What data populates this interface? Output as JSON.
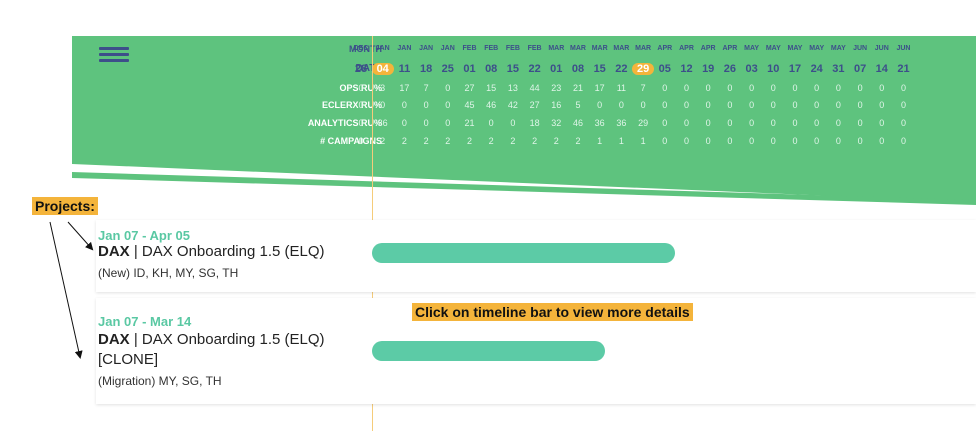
{
  "header": {
    "row_labels": [
      "MONTH",
      "DATE",
      "OPS RU%",
      "ECLERX RU%",
      "ANALYTICS RU%",
      "# CAMPAIGNS"
    ],
    "months": [
      "DEC",
      "JAN",
      "JAN",
      "JAN",
      "JAN",
      "FEB",
      "FEB",
      "FEB",
      "FEB",
      "MAR",
      "MAR",
      "MAR",
      "MAR",
      "MAR",
      "APR",
      "APR",
      "APR",
      "APR",
      "MAY",
      "MAY",
      "MAY",
      "MAY",
      "MAY",
      "JUN",
      "JUN",
      "JUN"
    ],
    "dates": [
      "28",
      "04",
      "11",
      "18",
      "25",
      "01",
      "08",
      "15",
      "22",
      "01",
      "08",
      "15",
      "22",
      "29",
      "05",
      "12",
      "19",
      "26",
      "03",
      "10",
      "17",
      "24",
      "31",
      "07",
      "14",
      "21"
    ],
    "highlighted_dates": [
      "04",
      "29"
    ],
    "ops_ru": [
      "0",
      "3",
      "17",
      "7",
      "0",
      "27",
      "15",
      "13",
      "44",
      "23",
      "21",
      "17",
      "11",
      "7",
      "0",
      "0",
      "0",
      "0",
      "0",
      "0",
      "0",
      "0",
      "0",
      "0",
      "0",
      "0"
    ],
    "eclerx_ru": [
      "0",
      "0",
      "0",
      "0",
      "0",
      "45",
      "46",
      "42",
      "27",
      "16",
      "5",
      "0",
      "0",
      "0",
      "0",
      "0",
      "0",
      "0",
      "0",
      "0",
      "0",
      "0",
      "0",
      "0",
      "0",
      "0"
    ],
    "analytics_ru": [
      "0",
      "36",
      "0",
      "0",
      "0",
      "21",
      "0",
      "0",
      "18",
      "32",
      "46",
      "36",
      "36",
      "29",
      "0",
      "0",
      "0",
      "0",
      "0",
      "0",
      "0",
      "0",
      "0",
      "0",
      "0",
      "0"
    ],
    "campaigns": [
      "0",
      "2",
      "2",
      "2",
      "2",
      "2",
      "2",
      "2",
      "2",
      "2",
      "2",
      "1",
      "1",
      "1",
      "0",
      "0",
      "0",
      "0",
      "0",
      "0",
      "0",
      "0",
      "0",
      "0",
      "0",
      "0"
    ]
  },
  "annotations": {
    "projects_label": "Projects:",
    "timeline_hint": "Click on timeline bar to view more details"
  },
  "projects": [
    {
      "dates": "Jan 07 - Apr 05",
      "client": "DAX",
      "separator": " | ",
      "title": "DAX Onboarding 1.5 (ELQ)",
      "meta": "(New) ID, KH, MY, SG, TH"
    },
    {
      "dates": "Jan 07 - Mar 14",
      "client": "DAX",
      "separator": " | ",
      "title": "DAX Onboarding 1.5 (ELQ) [CLONE]",
      "meta": "(Migration) MY, SG, TH"
    }
  ],
  "colors": {
    "header_green": "#5ec37e",
    "bar_teal": "#5ccba6",
    "accent_orange": "#f4b43b",
    "label_navy": "#3d4f8a"
  }
}
